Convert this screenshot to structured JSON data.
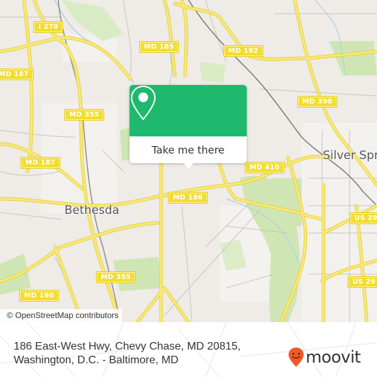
{
  "map": {
    "colors": {
      "land": "#efebe7",
      "park": "#cfe6b4",
      "road_major": "#f5e46a",
      "road_casing": "#e8cf3a",
      "water": "#a9d3e6",
      "rail": "#7a7a7a",
      "minor_road": "#c9c3bd"
    },
    "road_shields": [
      {
        "id": "i270",
        "label": "I 270"
      },
      {
        "id": "md187-top",
        "label": "MD 187"
      },
      {
        "id": "md185",
        "label": "MD 185"
      },
      {
        "id": "md192",
        "label": "MD 192"
      },
      {
        "id": "md355-top",
        "label": "MD 355"
      },
      {
        "id": "md390",
        "label": "MD 390"
      },
      {
        "id": "md187-mid",
        "label": "MD 187"
      },
      {
        "id": "md410",
        "label": "MD 410"
      },
      {
        "id": "md186",
        "label": "MD 186"
      },
      {
        "id": "us29-top",
        "label": "US 29"
      },
      {
        "id": "md355-bottom",
        "label": "MD 355"
      },
      {
        "id": "md190",
        "label": "MD 190"
      },
      {
        "id": "us29-bottom",
        "label": "US 29"
      }
    ],
    "place_labels": [
      {
        "id": "bethesda",
        "label": "Bethesda"
      },
      {
        "id": "silver-spring",
        "label": "Silver Spr"
      }
    ],
    "attribution": "© OpenStreetMap contributors"
  },
  "popup": {
    "icon": "location-pin-icon",
    "button_label": "Take me there",
    "accent": "#1eb96c"
  },
  "footer": {
    "address_line1": "186 East-West Hwy, Chevy Chase, MD 20815,",
    "address_line2": "Washington, D.C. - Baltimore, MD",
    "brand": "moovit",
    "brand_color": "#f05a28"
  }
}
